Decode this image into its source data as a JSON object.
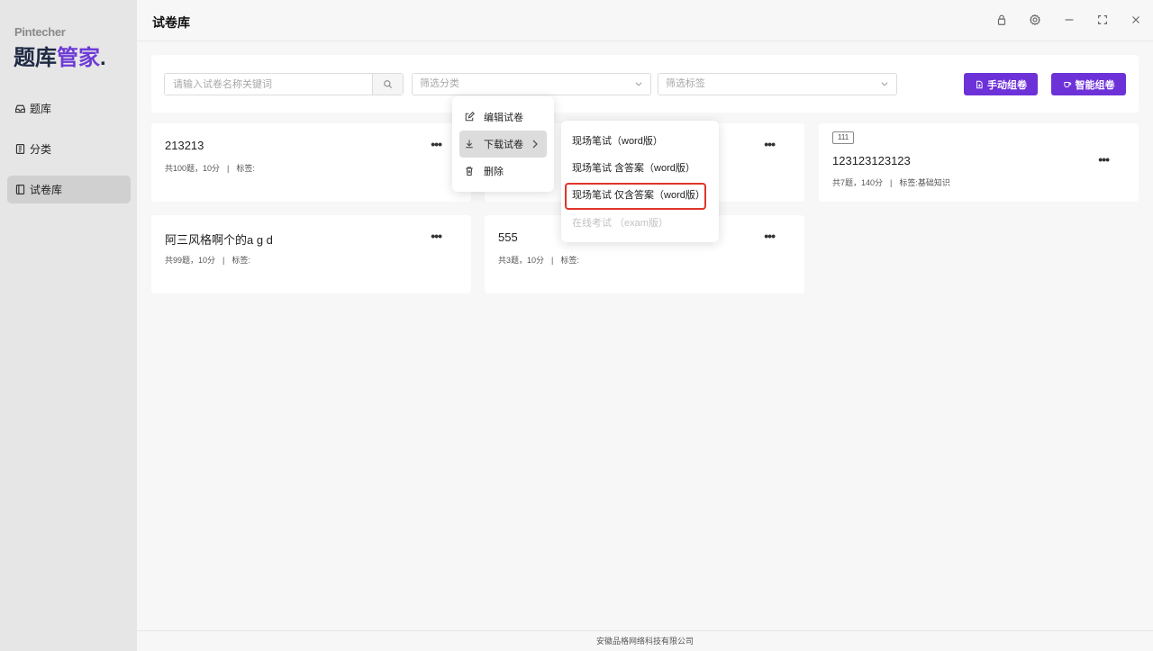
{
  "brand": {
    "sub": "Pintecher",
    "main_prefix": "题库",
    "main_accent": "管家",
    "main_dot": "."
  },
  "sidebar": {
    "items": [
      {
        "label": "题库",
        "icon": "inbox-icon",
        "active": false
      },
      {
        "label": "分类",
        "icon": "book-icon",
        "active": false
      },
      {
        "label": "试卷库",
        "icon": "notebook-icon",
        "active": true
      }
    ]
  },
  "header": {
    "title": "试卷库"
  },
  "window_controls": [
    "lock-icon",
    "settings-icon",
    "minimize-icon",
    "fullscreen-icon",
    "close-icon"
  ],
  "toolbar": {
    "search_placeholder": "请输入试卷名称关键词",
    "category_placeholder": "筛选分类",
    "tag_placeholder": "筛选标签",
    "manual_button": "手动组卷",
    "smart_button": "智能组卷"
  },
  "cards": [
    {
      "title": "213213",
      "count": "共100题，10分",
      "tags_label": "标签:",
      "tags": "",
      "badge": ""
    },
    {
      "title": "",
      "count": "",
      "tags_label": "",
      "tags": "",
      "badge": ""
    },
    {
      "title": "123123123123",
      "count": "共7题，140分",
      "tags_label": "标签:",
      "tags": "基础知识",
      "badge": "111"
    },
    {
      "title": "阿三风格啊个的a g d",
      "count": "共99题，10分",
      "tags_label": "标签:",
      "tags": "",
      "badge": ""
    },
    {
      "title": "555",
      "count": "共3题，10分",
      "tags_label": "标签:",
      "tags": "",
      "badge": ""
    }
  ],
  "separator": "|",
  "more_glyph": "•••",
  "context_menu": {
    "items": [
      {
        "label": "编辑试卷",
        "icon": "edit-icon"
      },
      {
        "label": "下载试卷",
        "icon": "download-icon",
        "has_submenu": true
      },
      {
        "label": "删除",
        "icon": "trash-icon"
      }
    ]
  },
  "submenu": {
    "items": [
      {
        "label": "现场笔试（word版）",
        "disabled": false
      },
      {
        "label": "现场笔试 含答案（word版）",
        "disabled": false
      },
      {
        "label": "现场笔试 仅含答案（word版）",
        "disabled": false,
        "highlighted": true
      },
      {
        "label": "在线考试 （exam版）",
        "disabled": true
      }
    ]
  },
  "footer": {
    "text": "安徽品格网络科技有限公司"
  },
  "colors": {
    "accent": "#6d31d8",
    "highlight": "#e0352b",
    "brand_dark": "#1f2a44"
  }
}
